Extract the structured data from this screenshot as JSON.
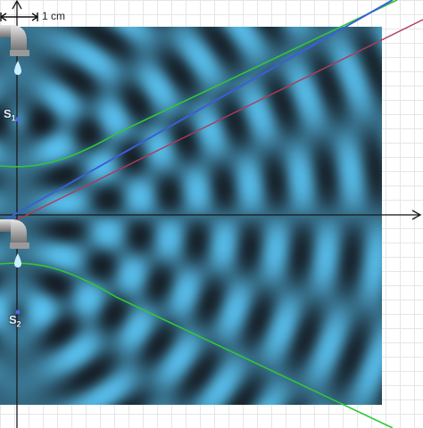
{
  "scale": {
    "label": "1 cm"
  },
  "sources": [
    {
      "letter": "S",
      "index": "1"
    },
    {
      "letter": "S",
      "index": "2"
    }
  ],
  "colors": {
    "wave_crest": "#5bc6f5",
    "wave_trough": "#12161c",
    "nodal_line": "#2fc73a",
    "blue_ray": "#3a5fd6",
    "red_ray": "#b03a58",
    "axis": "#1a1a1a"
  },
  "icons": [
    "faucet-icon",
    "water-drop-icon",
    "x-axis-arrow-icon",
    "y-axis-arrow-icon",
    "scale-bar-icon"
  ]
}
